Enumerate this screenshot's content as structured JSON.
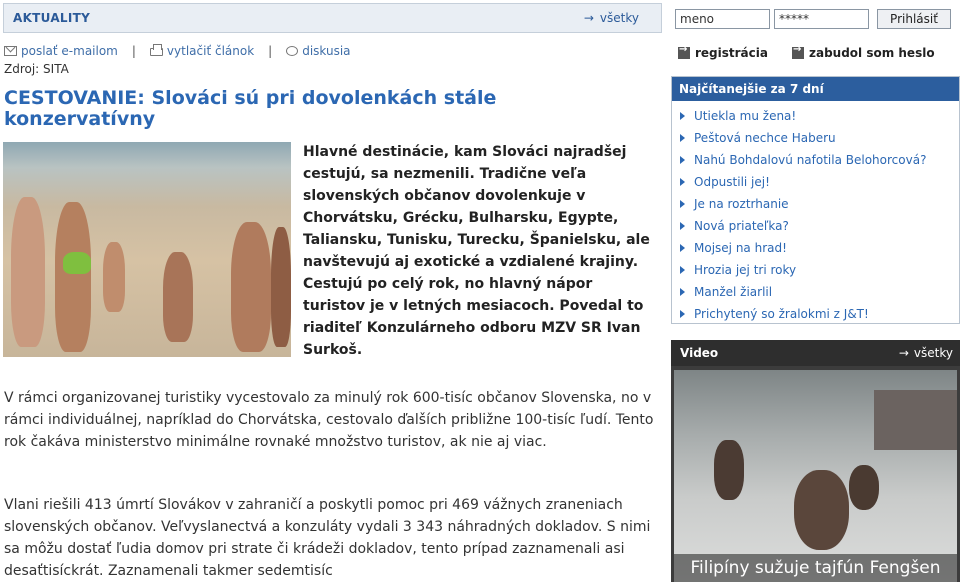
{
  "section": {
    "title": "AKTUALITY",
    "all_label": "všetky"
  },
  "tools": {
    "email_label": "poslať e-mailom",
    "print_label": "vytlačiť článok",
    "discuss_label": "diskusia",
    "separator": "|"
  },
  "source": "Zdroj: SITA",
  "article": {
    "headline": "CESTOVANIE: Slováci sú pri dovolenkách stále konzervatívny",
    "lead": "Hlavné destinácie, kam Slováci najradšej cestujú, sa nezmenili. Tradične veľa slovenských občanov dovolenkuje v Chorvátsku, Grécku, Bulharsku, Egypte, Taliansku, Tunisku, Turecku, Španielsku, ale navštevujú aj exotické a vzdialené krajiny. Cestujú po celý rok, no hlavný nápor turistov je v letných mesiacoch. Povedal to riaditeľ Konzulárneho odboru MZV SR Ivan Surkoš.",
    "paragraph1": "V rámci organizovanej turistiky vycestovalo za minulý rok 600-tisíc občanov Slovenska, no v rámci individuálnej, napríklad do Chorvátska, cestovalo ďalších približne 100-tisíc ľudí. Tento rok čakáva ministerstvo minimálne rovnaké množstvo turistov, ak nie aj viac.",
    "paragraph2": "Vlani riešili 413 úmrtí Slovákov v zahraničí a poskytli pomoc pri 469 vážnych zraneniach slovenských občanov. Veľvyslanectvá a konzuláty vydali 3 343 náhradných dokladov. S nimi sa môžu dostať ľudia domov pri strate či krádeži dokladov, tento prípad zaznamenali asi desaťtisíckrát. Zaznamenali takmer sedemtisíc"
  },
  "login": {
    "name_value": "meno",
    "password_value": "*****",
    "submit_label": "Prihlásiť",
    "register_label": "registrácia",
    "forgot_label": "zabudol som heslo"
  },
  "most_read": {
    "title": "Najčítanejšie za 7 dní",
    "items": [
      "Utiekla mu žena!",
      "Peštová nechce Haberu",
      "Nahú Bohdalovú nafotila Belohorcová?",
      "Odpustili jej!",
      "Je na roztrhanie",
      "Nová priateľka?",
      "Mojsej na hrad!",
      "Hrozia jej tri roky",
      "Manžel žiarlil",
      "Prichytený so žralokmi z J&T!"
    ]
  },
  "video": {
    "title": "Video",
    "all_label": "všetky",
    "caption": "Filipíny sužuje tajfún Fengšen"
  },
  "colors": {
    "link_blue": "#2b67b3",
    "header_blue": "#2c5e9e",
    "section_bg": "#e9eef4"
  }
}
